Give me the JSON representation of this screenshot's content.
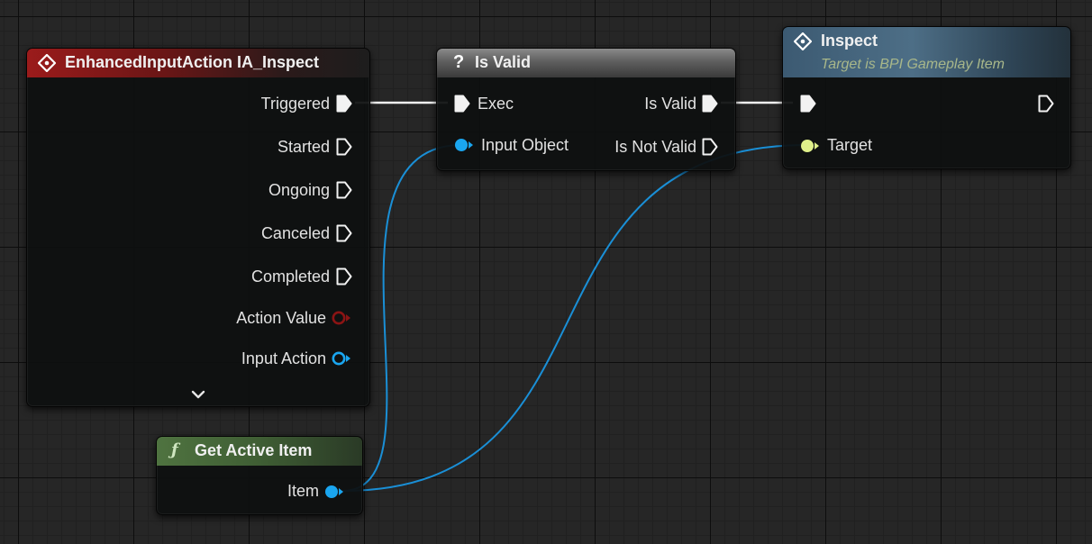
{
  "colors": {
    "exec": "#f2f2f2",
    "object_pin": "#1aa6f0",
    "interface_pin": "#dff08a",
    "struct_pin": "#8b1414",
    "object_wire": "#1a8fd6"
  },
  "nodes": {
    "input_event": {
      "title": "EnhancedInputAction IA_Inspect",
      "icon": "event-diamond-icon",
      "pins": {
        "triggered": "Triggered",
        "started": "Started",
        "ongoing": "Ongoing",
        "canceled": "Canceled",
        "completed": "Completed",
        "action_value": "Action Value",
        "input_action": "Input Action"
      },
      "expand_icon": "chevron-down-icon"
    },
    "is_valid": {
      "title": "Is Valid",
      "icon": "question-mark-icon",
      "pins": {
        "exec": "Exec",
        "input_object": "Input Object",
        "is_valid": "Is Valid",
        "is_not_valid": "Is Not Valid"
      }
    },
    "inspect": {
      "title": "Inspect",
      "subtitle": "Target is BPI Gameplay Item",
      "icon": "event-diamond-icon",
      "pins": {
        "target": "Target"
      }
    },
    "get_active_item": {
      "title": "Get Active Item",
      "icon": "function-icon",
      "pins": {
        "item": "Item"
      }
    }
  }
}
